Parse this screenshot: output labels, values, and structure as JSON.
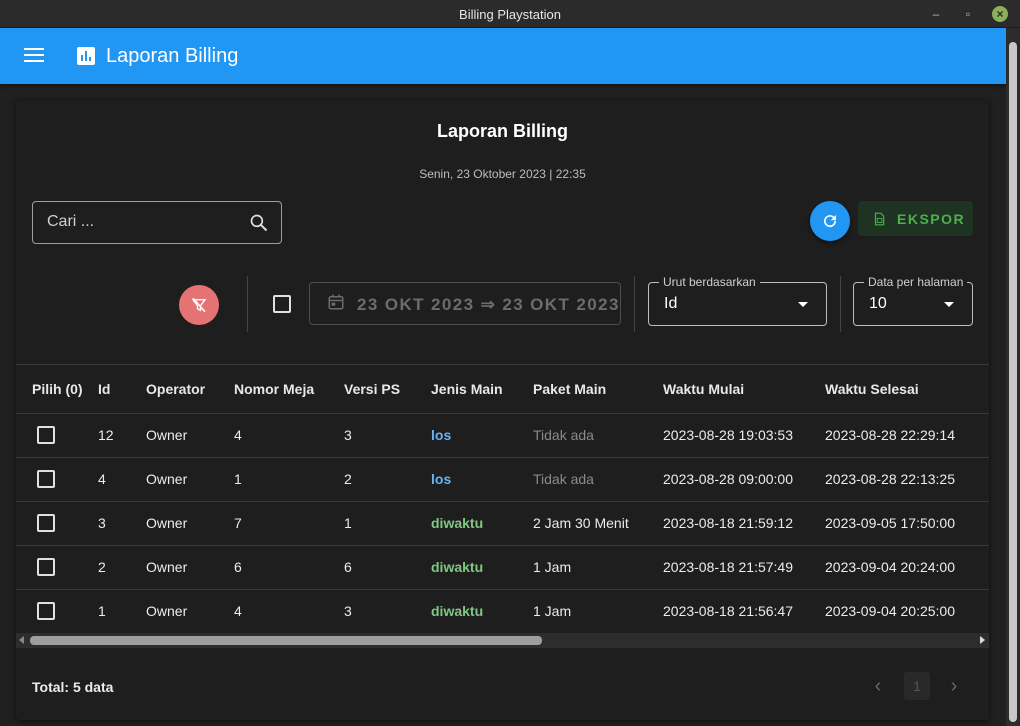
{
  "window": {
    "title": "Billing Playstation"
  },
  "appbar": {
    "title": "Laporan Billing"
  },
  "header": {
    "title": "Laporan Billing",
    "date": "Senin, 23 Oktober 2023 | 22:35"
  },
  "search": {
    "placeholder": "Cari ..."
  },
  "actions": {
    "export_label": "EKSPOR"
  },
  "filter": {
    "date_range": "23 OKT 2023 ⇒ 23 OKT 2023"
  },
  "sort": {
    "label": "Urut berdasarkan",
    "value": "Id"
  },
  "per_page": {
    "label": "Data per halaman",
    "value": "10"
  },
  "table": {
    "headers": [
      "Pilih (0)",
      "Id",
      "Operator",
      "Nomor Meja",
      "Versi PS",
      "Jenis Main",
      "Paket Main",
      "Waktu Mulai",
      "Waktu Selesai"
    ],
    "rows": [
      {
        "id": "12",
        "operator": "Owner",
        "meja": "4",
        "versi": "3",
        "jenis": "los",
        "paket": "Tidak ada",
        "mulai": "2023-08-28 19:03:53",
        "selesai": "2023-08-28 22:29:14"
      },
      {
        "id": "4",
        "operator": "Owner",
        "meja": "1",
        "versi": "2",
        "jenis": "los",
        "paket": "Tidak ada",
        "mulai": "2023-08-28 09:00:00",
        "selesai": "2023-08-28 22:13:25"
      },
      {
        "id": "3",
        "operator": "Owner",
        "meja": "7",
        "versi": "1",
        "jenis": "diwaktu",
        "paket": "2 Jam 30 Menit",
        "mulai": "2023-08-18 21:59:12",
        "selesai": "2023-09-05 17:50:00"
      },
      {
        "id": "2",
        "operator": "Owner",
        "meja": "6",
        "versi": "6",
        "jenis": "diwaktu",
        "paket": "1 Jam",
        "mulai": "2023-08-18 21:57:49",
        "selesai": "2023-09-04 20:24:00"
      },
      {
        "id": "1",
        "operator": "Owner",
        "meja": "4",
        "versi": "3",
        "jenis": "diwaktu",
        "paket": "1 Jam",
        "mulai": "2023-08-18 21:56:47",
        "selesai": "2023-09-04 20:25:00"
      }
    ]
  },
  "footer": {
    "total": "Total: 5 data",
    "page": "1"
  },
  "colors": {
    "primary": "#2196f3",
    "los": "#64b5f6",
    "diwaktu": "#81c784",
    "export": "#4caf50",
    "clear_filter": "#e57373"
  }
}
